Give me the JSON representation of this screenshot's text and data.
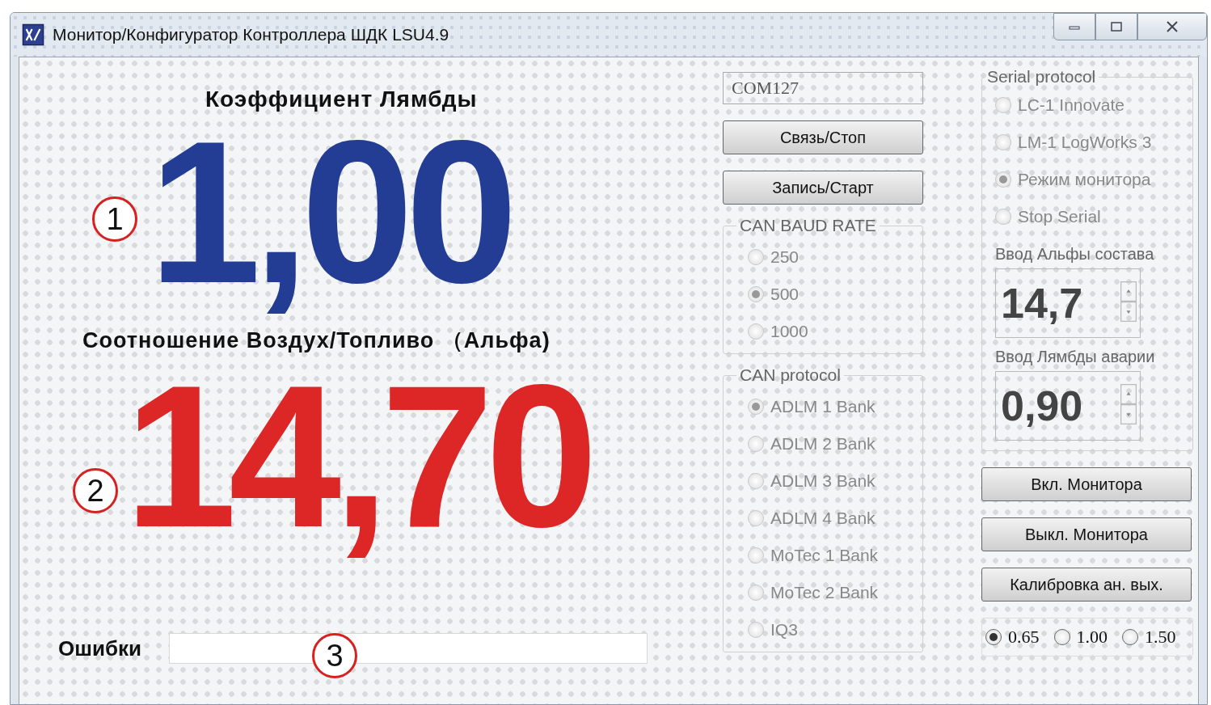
{
  "window": {
    "title": "Монитор/Конфигуратор  Контроллера ШДК LSU4.9"
  },
  "lambda": {
    "label": "Коэффициент Лямбды",
    "value": "1,00"
  },
  "afr": {
    "label": "Соотношение Воздух/Топливо （Альфа)",
    "value": "14,70"
  },
  "errors": {
    "label": "Ошибки"
  },
  "callouts": [
    "1",
    "2",
    "3"
  ],
  "port": {
    "value": "COM127"
  },
  "buttons_top": [
    "Связь/Стоп",
    "Запись/Старт"
  ],
  "can_baud_rate": {
    "title": "CAN BAUD RATE",
    "disabled": true,
    "options": [
      {
        "label": "250",
        "selected": false
      },
      {
        "label": "500",
        "selected": true
      },
      {
        "label": "1000",
        "selected": false
      }
    ]
  },
  "can_protocol": {
    "title": "CAN protocol",
    "disabled": true,
    "options": [
      {
        "label": "ADLM 1 Bank",
        "selected": true
      },
      {
        "label": "ADLM 2 Bank",
        "selected": false
      },
      {
        "label": "ADLM 3 Bank",
        "selected": false
      },
      {
        "label": "ADLM 4 Bank",
        "selected": false
      },
      {
        "label": "MoTec 1 Bank",
        "selected": false
      },
      {
        "label": "MoTec 2 Bank",
        "selected": false
      },
      {
        "label": "IQ3",
        "selected": false
      }
    ]
  },
  "serial_protocol": {
    "title": "Serial protocol",
    "disabled": true,
    "options": [
      {
        "label": "LC-1 Innovate",
        "selected": false
      },
      {
        "label": "LM-1  LogWorks 3",
        "selected": false
      },
      {
        "label": "Режим монитора",
        "selected": true
      },
      {
        "label": "Stop Serial",
        "selected": false
      }
    ]
  },
  "spinners": [
    {
      "label": "Ввод Альфы состава",
      "value": "14,7"
    },
    {
      "label": "Ввод Лямбды аварии",
      "value": "0,90"
    }
  ],
  "buttons_bottom": [
    "Вкл.  Монитора",
    "Выкл. Монитора",
    "Калибровка ан. вых."
  ],
  "analog_output": {
    "disabled": false,
    "options": [
      {
        "label": "0.65",
        "selected": true
      },
      {
        "label": "1.00",
        "selected": false
      },
      {
        "label": "1.50",
        "selected": false
      }
    ]
  }
}
